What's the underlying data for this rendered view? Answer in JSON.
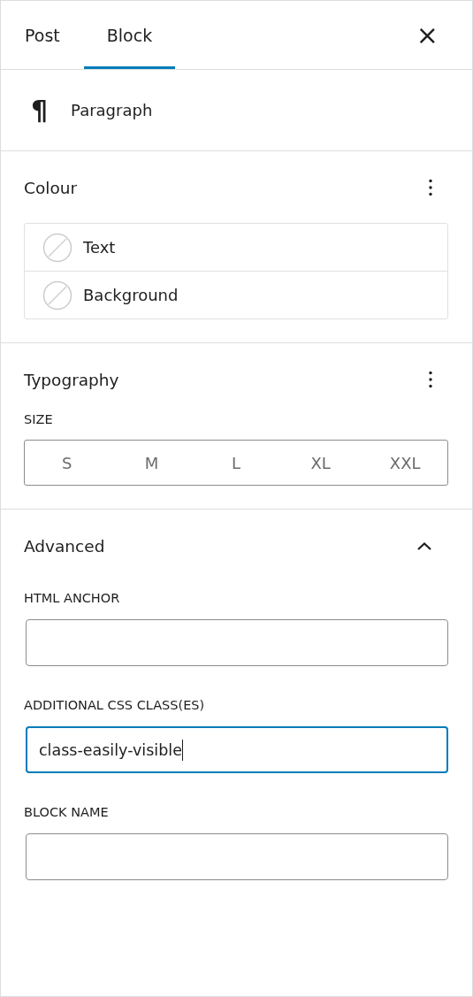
{
  "tabs": [
    {
      "label": "Post",
      "selected": false
    },
    {
      "label": "Block",
      "selected": true
    }
  ],
  "close_button": "×",
  "block": {
    "icon": "¶",
    "name": "Paragraph"
  },
  "colour": {
    "title": "Colour",
    "items": [
      {
        "label": "Text"
      },
      {
        "label": "Background"
      }
    ]
  },
  "typography": {
    "title": "Typography",
    "size_label": "SIZE",
    "sizes": [
      {
        "label": "S",
        "selected": false
      },
      {
        "label": "M",
        "selected": false
      },
      {
        "label": "L",
        "selected": false
      },
      {
        "label": "XL",
        "selected": false
      },
      {
        "label": "XXL",
        "selected": false
      }
    ]
  },
  "advanced": {
    "title": "Advanced",
    "expanded": true,
    "fields": [
      {
        "label": "HTML ANCHOR",
        "focused": false
      },
      {
        "label": "ADDITIONAL CSS CLASS(ES)",
        "value": "class-easily-visible",
        "focused": true
      },
      {
        "label": "BLOCK NAME",
        "focused": false
      }
    ]
  }
}
